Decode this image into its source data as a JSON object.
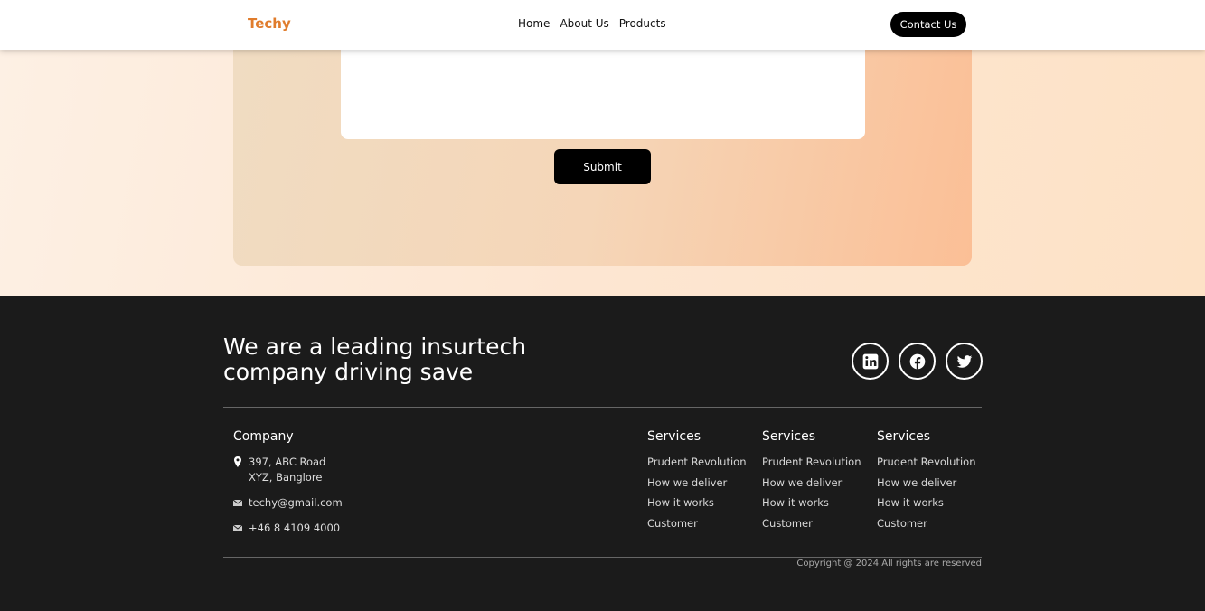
{
  "navbar": {
    "logo": "Techy",
    "links": [
      "Home",
      "About Us",
      "Products"
    ],
    "cta": "Contact Us"
  },
  "form": {
    "submit_label": "Submit"
  },
  "footer": {
    "tagline": "We are a leading insurtech company driving save",
    "socials": [
      "linkedin-icon",
      "facebook-icon",
      "twitter-icon"
    ],
    "company": {
      "title": "Company",
      "address_line1": "397, ABC Road",
      "address_line2": "XYZ, Banglore",
      "email": "techy@gmail.com",
      "phone": "+46 8 4109 4000"
    },
    "service_columns": [
      {
        "title": "Services",
        "links": [
          "Prudent Revolution",
          "How we deliver",
          "How it works",
          "Customer"
        ]
      },
      {
        "title": "Services",
        "links": [
          "Prudent Revolution",
          "How we deliver",
          "How it works",
          "Customer"
        ]
      },
      {
        "title": "Services",
        "links": [
          "Prudent Revolution",
          "How we deliver",
          "How it works",
          "Customer"
        ]
      }
    ],
    "copyright": "Copyright @ 2024 All rights are reserved"
  },
  "colors": {
    "brand": "#e07c2c",
    "footer_bg": "#1b1b1b",
    "button": "#000000"
  }
}
